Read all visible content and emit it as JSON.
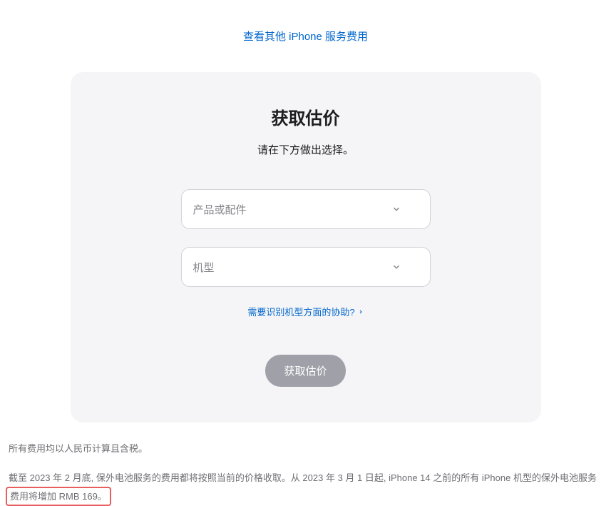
{
  "topLink": {
    "label": "查看其他 iPhone 服务费用"
  },
  "card": {
    "title": "获取估价",
    "subtitle": "请在下方做出选择。",
    "selectProduct": {
      "placeholder": "产品或配件"
    },
    "selectModel": {
      "placeholder": "机型"
    },
    "helpLink": {
      "label": "需要识别机型方面的协助?"
    },
    "submitButton": {
      "label": "获取估价"
    }
  },
  "footer": {
    "line1": "所有费用均以人民币计算且含税。",
    "line2_part1": "截至 2023 年 2 月底, 保外电池服务的费用都将按照当前的价格收取。从 2023 年 3 月 1 日起, iPhone 14 之前的所有 iPhone 机型的保外电池服务",
    "line2_highlight": "费用将增加 RMB 169。"
  }
}
